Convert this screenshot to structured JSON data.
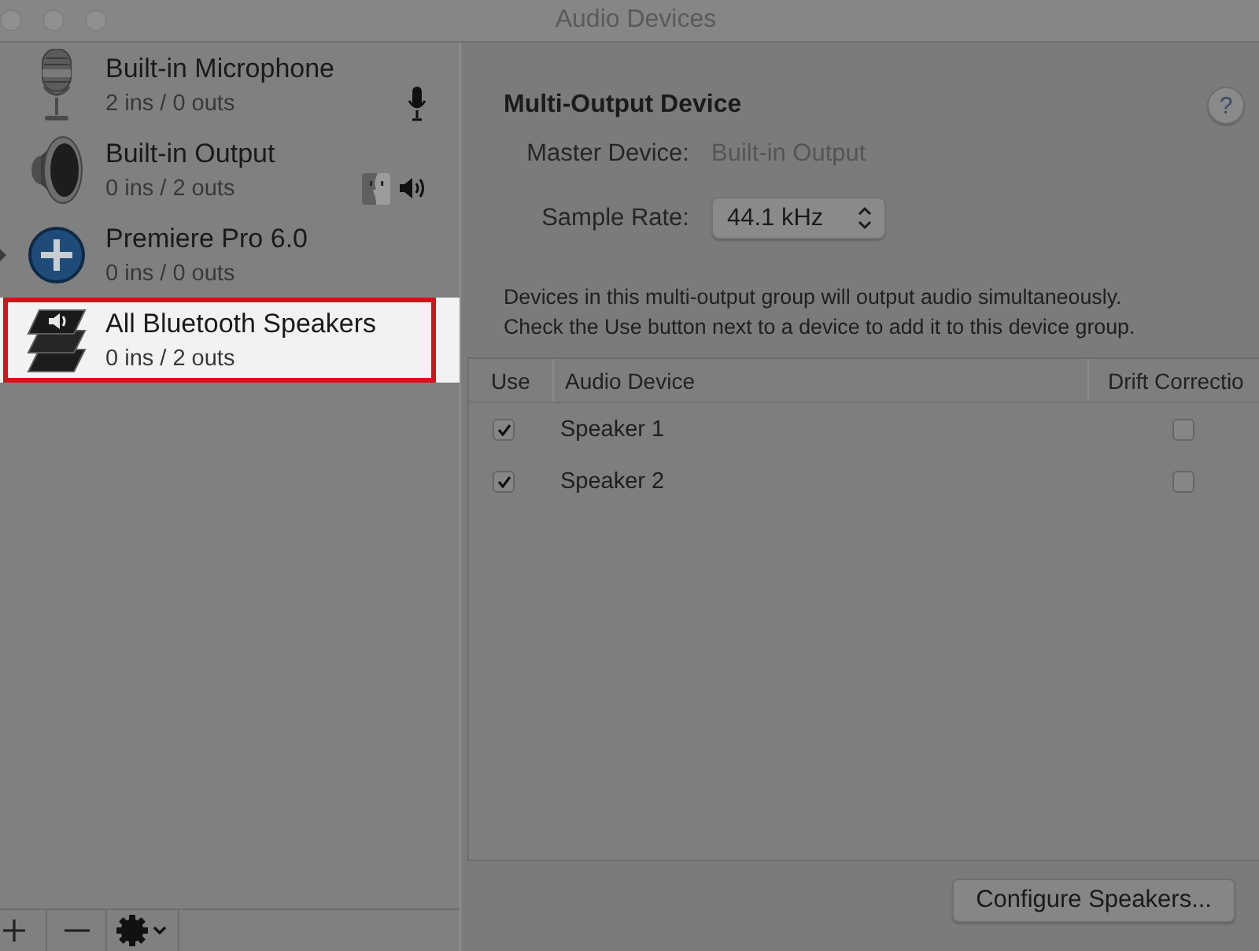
{
  "window": {
    "title": "Audio Devices"
  },
  "sidebar": {
    "devices": [
      {
        "kind": "microphone",
        "name": "Built-in Microphone",
        "io": "2 ins / 0 outs",
        "selected": false,
        "expandable": false,
        "default_input": true,
        "default_output": false,
        "system_output": false
      },
      {
        "kind": "speaker",
        "name": "Built-in Output",
        "io": "0 ins / 2 outs",
        "selected": false,
        "expandable": false,
        "default_input": false,
        "default_output": true,
        "system_output": true
      },
      {
        "kind": "aggregate",
        "name": "Premiere Pro 6.0",
        "io": "0 ins / 0 outs",
        "selected": false,
        "expandable": true,
        "default_input": false,
        "default_output": false,
        "system_output": false
      },
      {
        "kind": "multi_output",
        "name": "All Bluetooth Speakers",
        "io": "0 ins / 2 outs",
        "selected": true,
        "expandable": false,
        "default_input": false,
        "default_output": false,
        "system_output": false
      }
    ]
  },
  "detail": {
    "title": "Multi-Output Device",
    "help": "?",
    "master_device": {
      "label": "Master Device:",
      "value": "Built-in Output"
    },
    "sample_rate": {
      "label": "Sample Rate:",
      "value": "44.1 kHz"
    },
    "description": [
      "Devices in this multi-output group will output audio simultaneously.",
      "Check the Use button next to a device to add it to this device group."
    ],
    "table": {
      "columns": [
        "Use",
        "Audio Device",
        "Drift Correctio"
      ],
      "rows": [
        {
          "use": true,
          "device": "Speaker 1",
          "drift_correction": false
        },
        {
          "use": true,
          "device": "Speaker 2",
          "drift_correction": false
        }
      ]
    },
    "buttons": [
      "Configure Speakers..."
    ]
  }
}
